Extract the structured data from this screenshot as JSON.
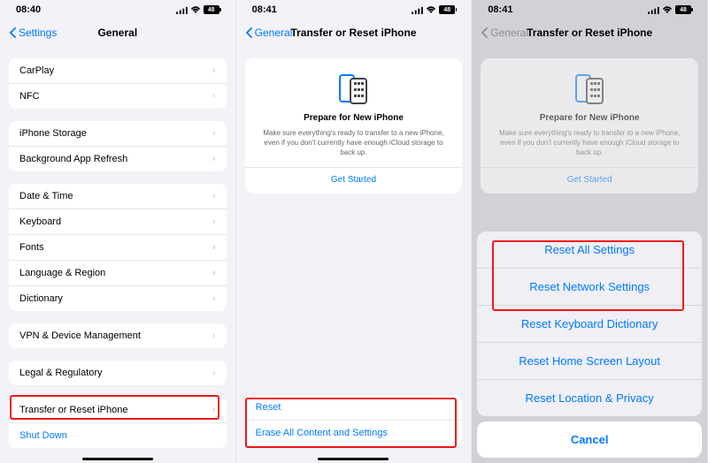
{
  "screen1": {
    "time": "08:40",
    "battery": "48",
    "back_label": "Settings",
    "title": "General",
    "groups": [
      {
        "rows": [
          {
            "label": "CarPlay"
          },
          {
            "label": "NFC"
          }
        ]
      },
      {
        "rows": [
          {
            "label": "iPhone Storage"
          },
          {
            "label": "Background App Refresh"
          }
        ]
      },
      {
        "rows": [
          {
            "label": "Date & Time"
          },
          {
            "label": "Keyboard"
          },
          {
            "label": "Fonts"
          },
          {
            "label": "Language & Region"
          },
          {
            "label": "Dictionary"
          }
        ]
      },
      {
        "rows": [
          {
            "label": "VPN & Device Management"
          }
        ]
      },
      {
        "rows": [
          {
            "label": "Legal & Regulatory"
          }
        ]
      },
      {
        "rows": [
          {
            "label": "Transfer or Reset iPhone"
          },
          {
            "label": "Shut Down",
            "link": true,
            "no_chevron": true
          }
        ]
      }
    ]
  },
  "screen2": {
    "time": "08:41",
    "battery": "48",
    "back_label": "General",
    "title": "Transfer or Reset iPhone",
    "card": {
      "title": "Prepare for New iPhone",
      "desc": "Make sure everything's ready to transfer to a new iPhone, even if you don't currently have enough iCloud storage to back up.",
      "link": "Get Started"
    },
    "bottom": [
      {
        "label": "Reset"
      },
      {
        "label": "Erase All Content and Settings"
      }
    ]
  },
  "screen3": {
    "time": "08:41",
    "battery": "48",
    "back_label": "General",
    "title": "Transfer or Reset iPhone",
    "card": {
      "title": "Prepare for New iPhone",
      "desc": "Make sure everything's ready to transfer to a new iPhone, even if you don't currently have enough iCloud storage to back up.",
      "link": "Get Started"
    },
    "sheet": {
      "options": [
        "Reset All Settings",
        "Reset Network Settings",
        "Reset Keyboard Dictionary",
        "Reset Home Screen Layout",
        "Reset Location & Privacy"
      ],
      "cancel": "Cancel"
    }
  }
}
